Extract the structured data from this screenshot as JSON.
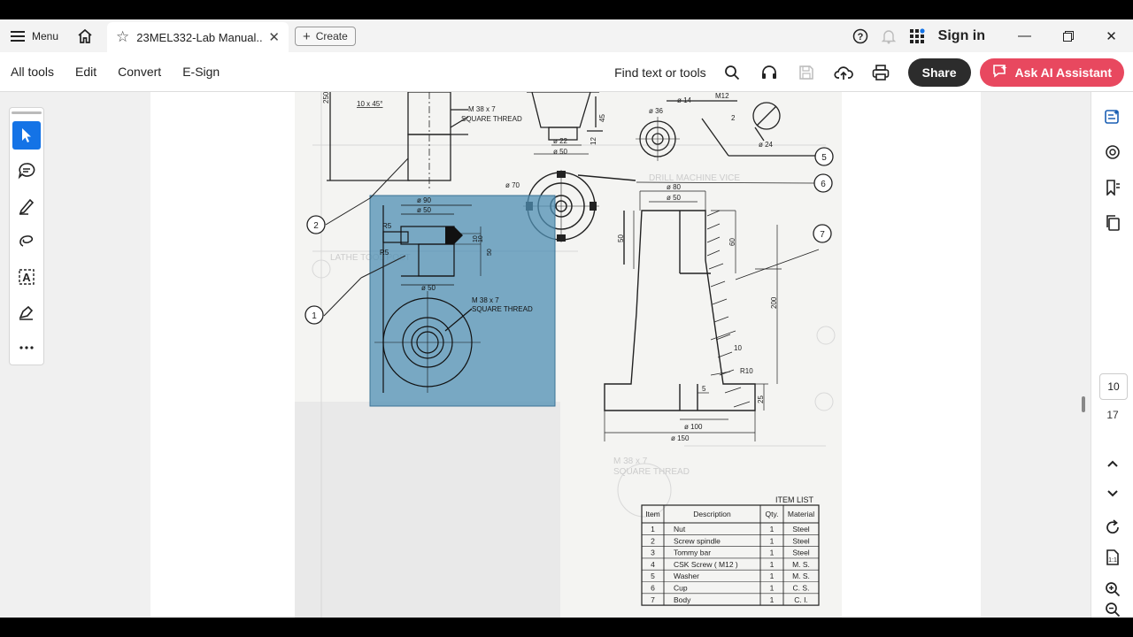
{
  "titlebar": {
    "menu_label": "Menu",
    "tab_title": "23MEL332-Lab Manual...",
    "create_label": "Create",
    "signin_label": "Sign in"
  },
  "toolbar": {
    "all_tools": "All tools",
    "edit": "Edit",
    "convert": "Convert",
    "esign": "E-Sign",
    "find_text": "Find text or tools",
    "share": "Share",
    "ai_assistant": "Ask AI Assistant"
  },
  "pagenav": {
    "current_page": "10",
    "total_pages": "17"
  },
  "drawing": {
    "item_list_title": "ITEM LIST",
    "item_list_headers": [
      "Item",
      "Description",
      "Qty.",
      "Material"
    ],
    "items": [
      {
        "item": "1",
        "description": "Nut",
        "qty": "1",
        "material": "Steel"
      },
      {
        "item": "2",
        "description": "Screw spindle",
        "qty": "1",
        "material": "Steel"
      },
      {
        "item": "3",
        "description": "Tommy bar",
        "qty": "1",
        "material": "Steel"
      },
      {
        "item": "4",
        "description": "CSK Screw ( M12 )",
        "qty": "1",
        "material": "M. S."
      },
      {
        "item": "5",
        "description": "Washer",
        "qty": "1",
        "material": "M. S."
      },
      {
        "item": "6",
        "description": "Cup",
        "qty": "1",
        "material": "C. S."
      },
      {
        "item": "7",
        "description": "Body",
        "qty": "1",
        "material": "C. I."
      }
    ],
    "labels": {
      "chamfer": "10 x 45°",
      "thread1_size": "M 38 x 7",
      "thread1_type": "SQUARE THREAD",
      "m12": "M12",
      "d36": "ø 36",
      "d14": "ø 14",
      "d22": "ø 22",
      "d50_top": "ø 50",
      "d24": "ø 24",
      "two": "2",
      "d70": "ø 70",
      "d90": "ø 90",
      "d50_a": "ø 50",
      "r5_a": "R5",
      "r5_b": "R5",
      "ten_a": "10",
      "ten_b": "10",
      "fifty_v": "50",
      "d50_b": "ø 50",
      "thread2_size": "M 38 x 7",
      "thread2_type": "SQUARE THREAD",
      "d80": "ø 80",
      "d50_c": "ø 50",
      "fifty_body": "50",
      "sixty": "60",
      "two_hundred": "200",
      "ten_c": "10",
      "r10": "R10",
      "five": "5",
      "twenty_five": "25",
      "d100": "ø 100",
      "d150": "ø 150",
      "n12": "12",
      "n45": "45",
      "n250": "250"
    },
    "balloons": [
      "1",
      "2",
      "5",
      "6",
      "7"
    ]
  }
}
